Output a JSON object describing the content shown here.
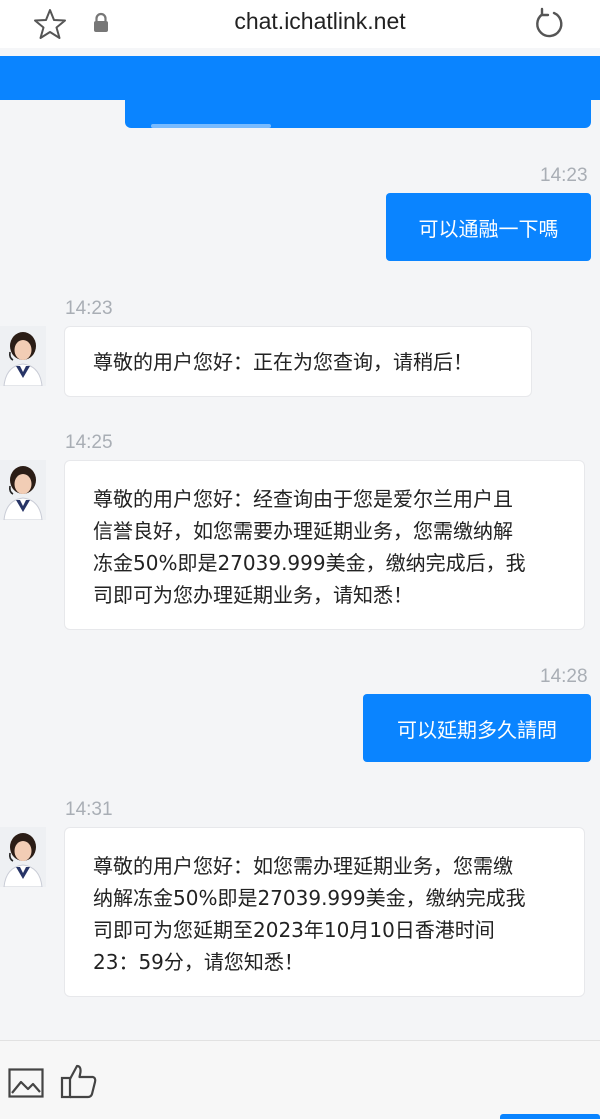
{
  "browser": {
    "url": "chat.ichatlink.net",
    "icons": [
      "star-icon",
      "lock-icon",
      "reload-icon"
    ]
  },
  "colors": {
    "accent": "#0a84ff",
    "background": "#f4f5f7",
    "timestamp": "#a9aeb5"
  },
  "messages": [
    {
      "side": "out",
      "time": "14:23",
      "text": "可以通融一下嗎"
    },
    {
      "side": "in",
      "time": "14:23",
      "text": "尊敬的用户您好：正在为您查询，请稍后！"
    },
    {
      "side": "in",
      "time": "14:25",
      "lines": [
        "尊敬的用户您好：经查询由于您是爱尔兰用户且",
        "信誉良好，如您需要办理延期业务，您需缴纳解",
        "冻金50%即是27039.999美金，缴纳完成后，我",
        "司即可为您办理延期业务，请知悉！"
      ]
    },
    {
      "side": "out",
      "time": "14:28",
      "text": "可以延期多久請問"
    },
    {
      "side": "in",
      "time": "14:31",
      "lines": [
        "尊敬的用户您好：如您需办理延期业务，您需缴",
        "纳解冻金50%即是27039.999美金，缴纳完成我",
        "司即可为您延期至2023年10月10日香港时间",
        "23：59分，请您知悉！"
      ]
    }
  ],
  "toolbar": {
    "icons": [
      "image-icon",
      "thumbs-up-icon"
    ]
  }
}
